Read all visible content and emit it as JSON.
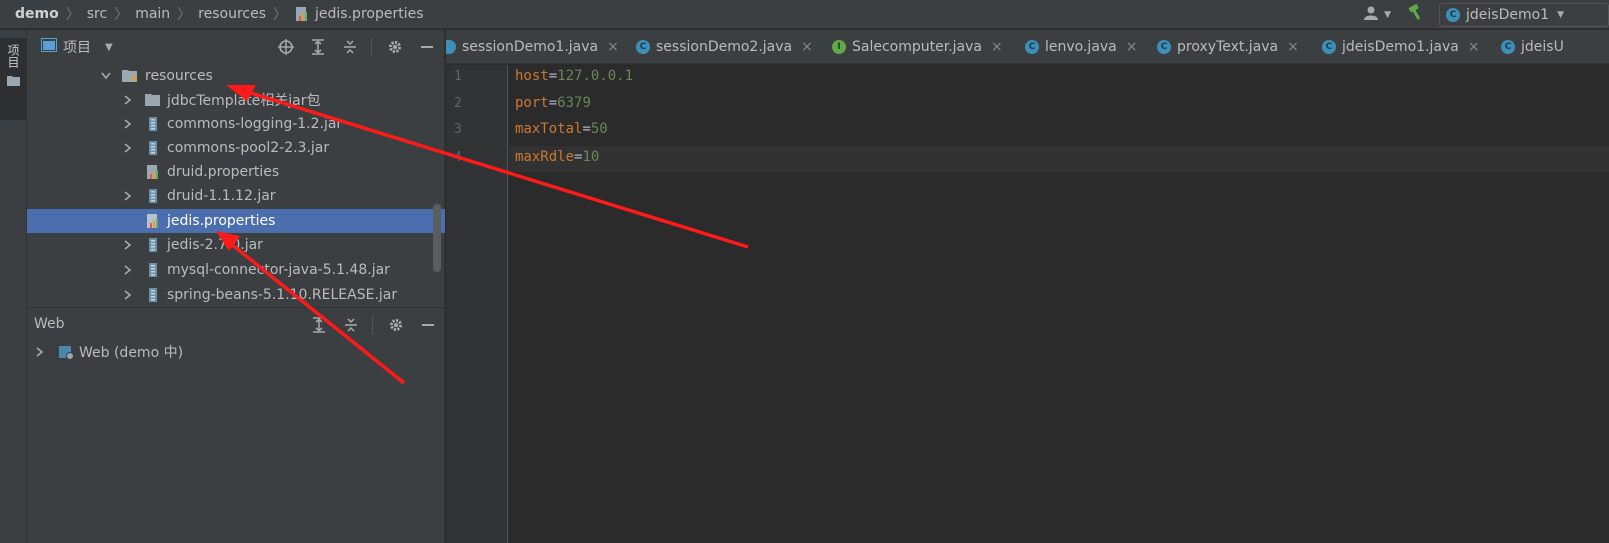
{
  "breadcrumb": [
    "demo",
    "src",
    "main",
    "resources",
    "jedis.properties"
  ],
  "run_config": {
    "label": "jdeisDemo1"
  },
  "left_strip": {
    "label": "项目"
  },
  "project_panel": {
    "title": "项目",
    "tree": [
      {
        "label": "resources",
        "icon": "folder-resources-icon",
        "expanded": true
      },
      {
        "label": "jdbcTemplate相关jar包",
        "icon": "folder-icon"
      },
      {
        "label": "commons-logging-1.2.jar",
        "icon": "jar-icon"
      },
      {
        "label": "commons-pool2-2.3.jar",
        "icon": "jar-icon"
      },
      {
        "label": "druid.properties",
        "icon": "properties-icon"
      },
      {
        "label": "druid-1.1.12.jar",
        "icon": "jar-icon"
      },
      {
        "label": "jedis.properties",
        "icon": "properties-icon",
        "selected": true
      },
      {
        "label": "jedis-2.7.0.jar",
        "icon": "jar-icon"
      },
      {
        "label": "mysql-connector-java-5.1.48.jar",
        "icon": "jar-icon"
      },
      {
        "label": "spring-beans-5.1.10.RELEASE.jar",
        "icon": "jar-icon"
      }
    ]
  },
  "web_panel": {
    "title": "Web",
    "items": [
      {
        "label": "Web (demo 中)"
      }
    ]
  },
  "editor": {
    "tabs": [
      {
        "label": "sessionDemo1.java",
        "icon": "C"
      },
      {
        "label": "sessionDemo2.java",
        "icon": "C"
      },
      {
        "label": "Salecomputer.java",
        "icon": "I"
      },
      {
        "label": "lenvo.java",
        "icon": "C"
      },
      {
        "label": "proxyText.java",
        "icon": "C"
      },
      {
        "label": "jdeisDemo1.java",
        "icon": "C"
      },
      {
        "label": "jdeisU",
        "icon": "C"
      }
    ],
    "lines": [
      {
        "number": "1",
        "key": "host",
        "eq": "=",
        "value": "127.0.0.1"
      },
      {
        "number": "2",
        "key": "port",
        "eq": "=",
        "value": "6379"
      },
      {
        "number": "3",
        "key": "maxTotal",
        "eq": "=",
        "value": "50"
      },
      {
        "number": "4",
        "key": "maxRdle",
        "eq": "=",
        "value": "10"
      }
    ]
  },
  "colors": {
    "key": "#cc7832",
    "value": "#6a8759",
    "selection": "#4b6eaf",
    "annotation_arrow": "#ff1a1a"
  }
}
